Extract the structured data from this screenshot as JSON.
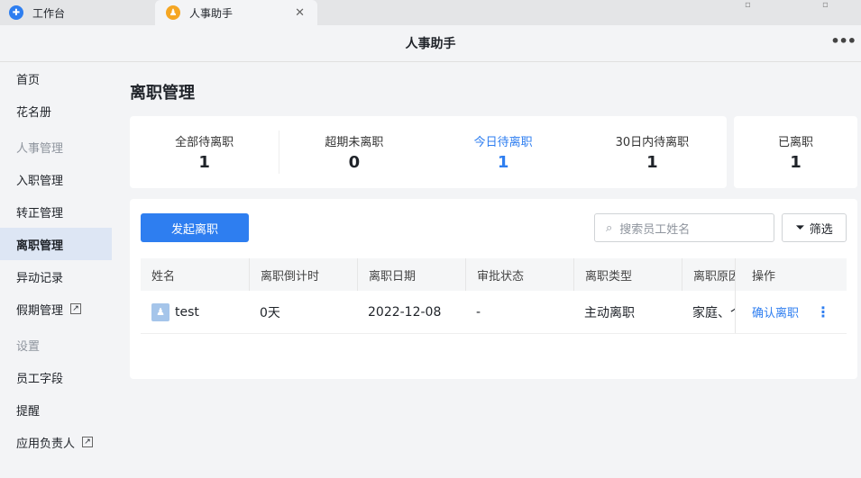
{
  "tabs": [
    {
      "label": "工作台",
      "icon": "workbench-icon"
    },
    {
      "label": "人事助手",
      "icon": "hr-assistant-icon"
    }
  ],
  "header": {
    "title": "人事助手"
  },
  "sidebar": {
    "items": [
      {
        "label": "首页",
        "type": "item"
      },
      {
        "label": "花名册",
        "type": "item"
      },
      {
        "label": "人事管理",
        "type": "group"
      },
      {
        "label": "入职管理",
        "type": "item"
      },
      {
        "label": "转正管理",
        "type": "item"
      },
      {
        "label": "离职管理",
        "type": "item",
        "active": true
      },
      {
        "label": "异动记录",
        "type": "item"
      },
      {
        "label": "假期管理",
        "type": "item",
        "external": true
      },
      {
        "label": "设置",
        "type": "group"
      },
      {
        "label": "员工字段",
        "type": "item"
      },
      {
        "label": "提醒",
        "type": "item"
      },
      {
        "label": "应用负责人",
        "type": "item",
        "external": true
      }
    ]
  },
  "page": {
    "title": "离职管理"
  },
  "stats": [
    {
      "label": "全部待离职",
      "value": "1"
    },
    {
      "label": "超期未离职",
      "value": "0"
    },
    {
      "label": "今日待离职",
      "value": "1",
      "active": true
    },
    {
      "label": "30日内待离职",
      "value": "1"
    }
  ],
  "left_stat": {
    "label": "已离职",
    "value": "1"
  },
  "toolbar": {
    "start_label": "发起离职",
    "search_placeholder": "搜索员工姓名",
    "filter_label": "筛选"
  },
  "table": {
    "columns": [
      "姓名",
      "离职倒计时",
      "离职日期",
      "审批状态",
      "离职类型",
      "离职原因",
      "操作"
    ],
    "rows": [
      {
        "name": "test",
        "countdown": "0天",
        "date": "2022-12-08",
        "approval": "-",
        "type": "主动离职",
        "reason": "家庭、个",
        "action": "确认离职"
      }
    ]
  },
  "colors": {
    "accent": "#2e7ef0"
  }
}
